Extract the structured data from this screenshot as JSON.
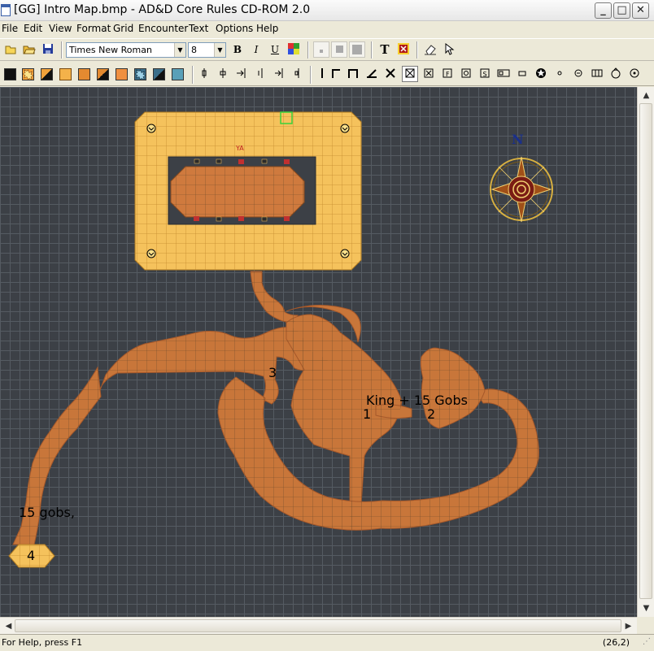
{
  "window": {
    "title": "[GG] Intro Map.bmp - AD&D Core Rules CD-ROM 2.0",
    "buttons": {
      "minimize": "_",
      "maximize": "□",
      "close": "✕"
    }
  },
  "menu": [
    "File",
    "Edit",
    "View",
    "Format",
    "Grid",
    "Encounter",
    "Text",
    "Options",
    "Help"
  ],
  "toolbar": {
    "font_name": "Times New Roman",
    "font_size": "8",
    "bold": "B",
    "italic": "I",
    "underline": "U",
    "text_tool": "T"
  },
  "map": {
    "labels": {
      "room3": "3",
      "king": "King + 15 Gobs",
      "room1": "1",
      "room2": "2",
      "gobs": "15 gobs,",
      "room4": "4",
      "ya": "YA"
    },
    "compass_letter": "N",
    "colors": {
      "grid_bg": "#3c4046",
      "room_floor": "#f5c25c",
      "cave_floor": "#c8763a",
      "table": "#cf7a3e"
    }
  },
  "status": {
    "help": "For Help, press F1",
    "coords": "(26,2)"
  }
}
